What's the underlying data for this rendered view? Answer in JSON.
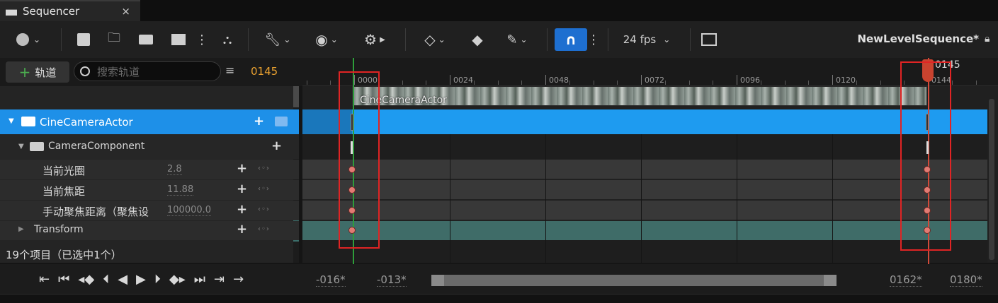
{
  "window": {
    "tab_title": "Sequencer",
    "close_glyph": "×"
  },
  "toolbar": {
    "fps_label": "24 fps",
    "sequence_name": "NewLevelSequence*"
  },
  "track_bar": {
    "add_track_label": "轨道",
    "search_placeholder": "搜索轨道",
    "current_frame": "0145"
  },
  "outliner": {
    "rows": [
      {
        "label": "CineCameraActor"
      },
      {
        "label": "CameraComponent"
      },
      {
        "label": "当前光圈",
        "value": "2.8"
      },
      {
        "label": "当前焦距",
        "value": "11.88"
      },
      {
        "label": "手动聚焦距离（聚焦设",
        "value": "100000.0"
      },
      {
        "label": "Transform"
      }
    ],
    "status": "19个项目（已选中1个）"
  },
  "ruler": {
    "ticks": [
      "0000",
      "0024",
      "0048",
      "0072",
      "0096",
      "0120",
      "0144"
    ],
    "playhead_frame": "0145",
    "clip_label": "CineCameraActor"
  },
  "bottom": {
    "range_start_outer": "-016*",
    "range_start_inner": "-013*",
    "range_end_inner": "0162*",
    "range_end_outer": "0180*"
  },
  "colors": {
    "selection": "#1e90e8",
    "accent_orange": "#e8a030",
    "key": "#e27b73",
    "highlight_box": "#e02424"
  },
  "icons": [
    "world-icon",
    "save-icon",
    "find-asset-icon",
    "camera-icon",
    "clapper-icon",
    "actor-icon",
    "wrench-icon",
    "eye-icon",
    "gear-icon",
    "key-icon",
    "tag-icon",
    "pen-icon",
    "magnet-icon",
    "curve-editor-icon"
  ]
}
